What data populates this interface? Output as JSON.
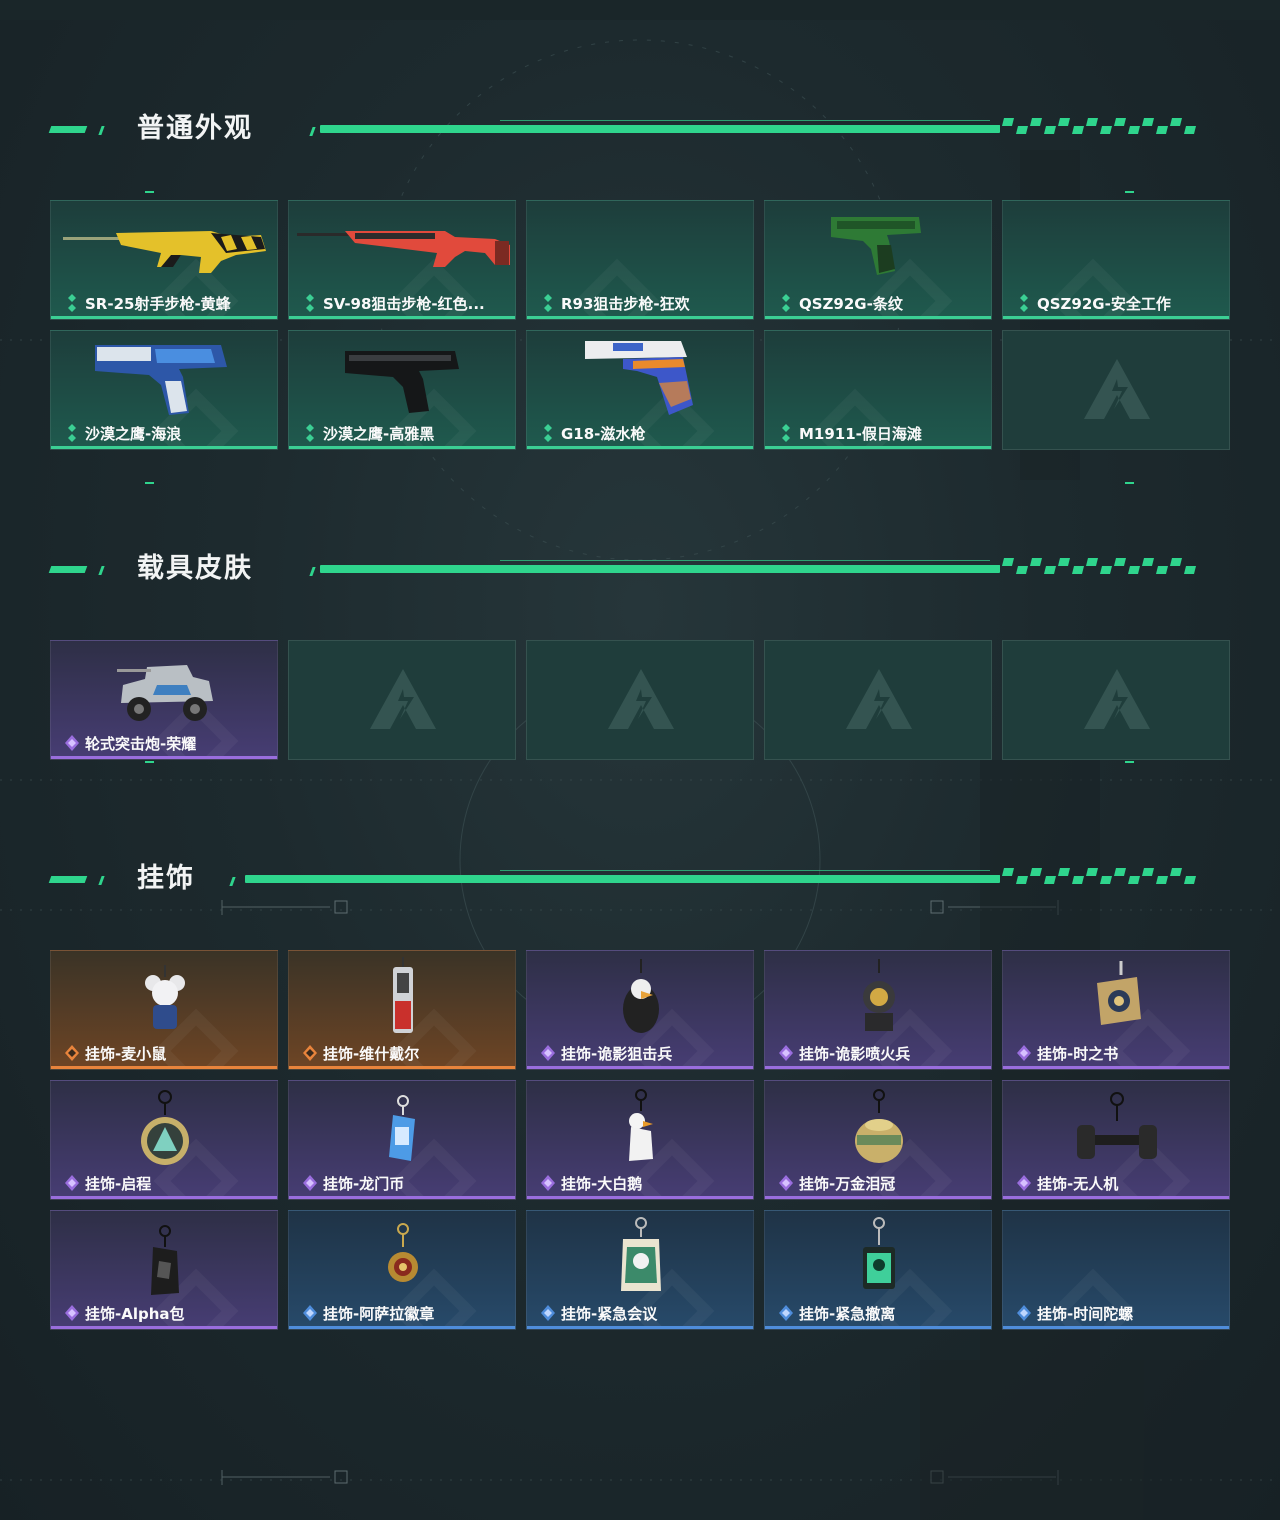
{
  "sections": [
    {
      "title": "普通外观",
      "items": [
        {
          "label": "SR-25射手步枪-黄蜂"
        },
        {
          "label": "SV-98狙击步枪-红色..."
        },
        {
          "label": "R93狙击步枪-狂欢"
        },
        {
          "label": "QSZ92G-条纹"
        },
        {
          "label": "QSZ92G-安全工作"
        },
        {
          "label": "沙漠之鹰-海浪"
        },
        {
          "label": "沙漠之鹰-高雅黑"
        },
        {
          "label": "G18-滋水枪"
        },
        {
          "label": "M1911-假日海滩"
        }
      ]
    },
    {
      "title": "载具皮肤",
      "items": [
        {
          "label": "轮式突击炮-荣耀"
        }
      ]
    },
    {
      "title": "挂饰",
      "items": [
        {
          "label": "挂饰-麦小鼠"
        },
        {
          "label": "挂饰-维什戴尔"
        },
        {
          "label": "挂饰-诡影狙击兵"
        },
        {
          "label": "挂饰-诡影喷火兵"
        },
        {
          "label": "挂饰-时之书"
        },
        {
          "label": "挂饰-启程"
        },
        {
          "label": "挂饰-龙门币"
        },
        {
          "label": "挂饰-大白鹅"
        },
        {
          "label": "挂饰-万金泪冠"
        },
        {
          "label": "挂饰-无人机"
        },
        {
          "label": "挂饰-Alpha包"
        },
        {
          "label": "挂饰-阿萨拉徽章"
        },
        {
          "label": "挂饰-紧急会议"
        },
        {
          "label": "挂饰-紧急撤离"
        },
        {
          "label": "挂饰-时间陀螺"
        }
      ]
    }
  ],
  "colors": {
    "accent": "#2fd58d",
    "rarity_green": "#3bcf94",
    "rarity_purple": "#9a6ede",
    "rarity_orange": "#e8843c",
    "rarity_blue": "#4f8ddb"
  },
  "icons": {
    "rarity_green": "green-diamonds-icon",
    "rarity_purple": "purple-diamonds-icon",
    "rarity_orange": "orange-diamond-icon",
    "rarity_blue": "blue-diamonds-icon",
    "empty_slot": "delta-logo-icon"
  }
}
